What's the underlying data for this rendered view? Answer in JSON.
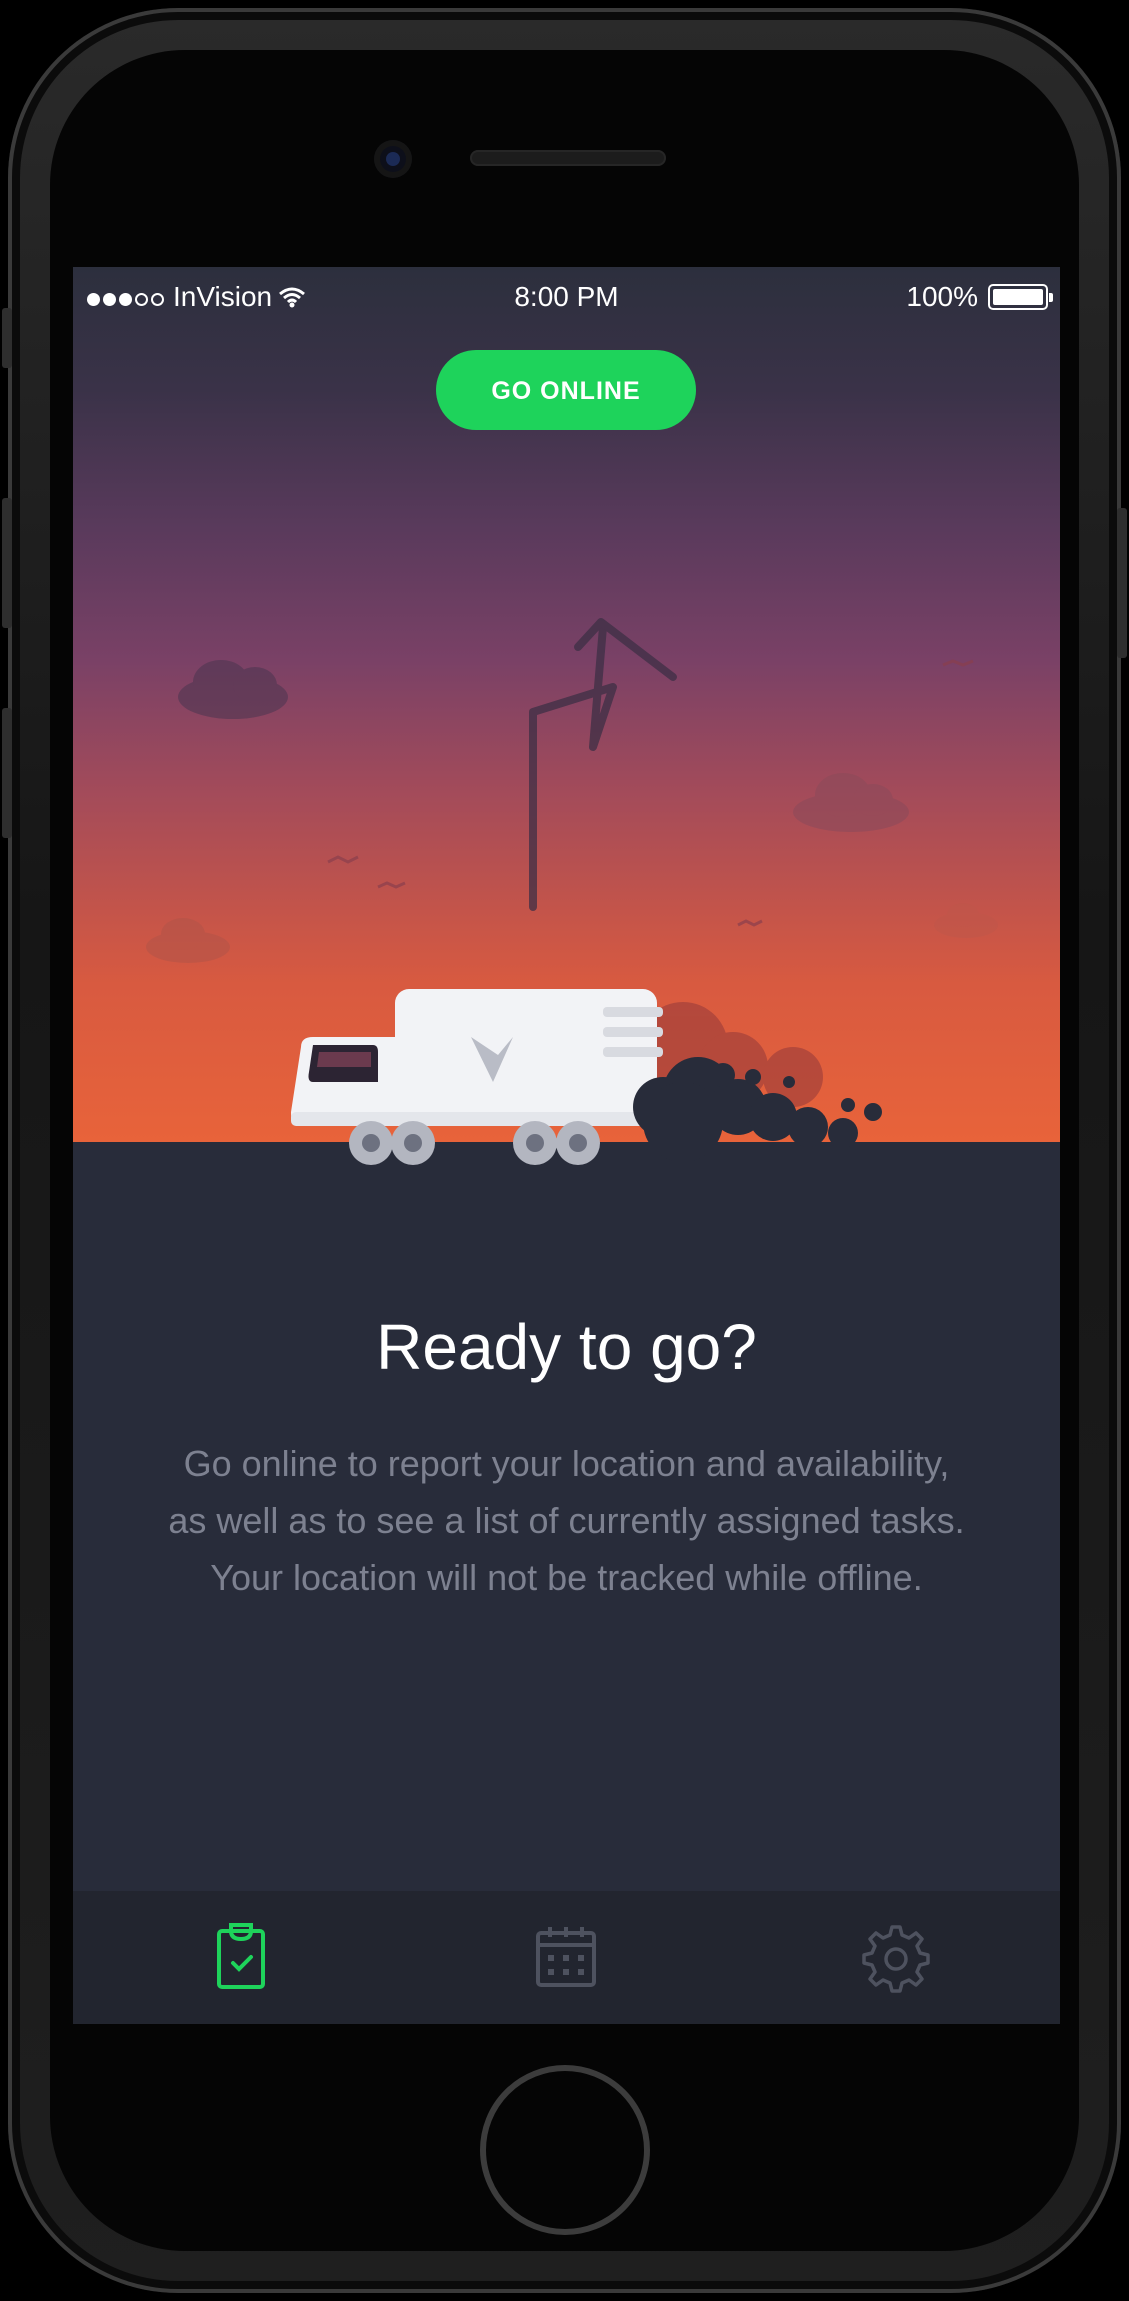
{
  "status_bar": {
    "carrier": "InVision",
    "time": "8:00 PM",
    "battery": "100%",
    "signal_dots_filled": 3,
    "signal_dots_total": 5
  },
  "header": {
    "go_online_label": "GO ONLINE"
  },
  "main": {
    "title": "Ready to go?",
    "description": "Go online to report your location and availability, as well as to see a list of currently assigned tasks. Your location will not be tracked while offline."
  },
  "tabbar": {
    "items": [
      {
        "icon": "clipboard-check-icon",
        "active": true
      },
      {
        "icon": "calendar-icon",
        "active": false
      },
      {
        "icon": "gear-icon",
        "active": false
      }
    ]
  },
  "colors": {
    "accent": "#1ed35b",
    "background": "#282c3a",
    "tabbar": "#22252f",
    "sky_bottom": "#e8633a"
  }
}
